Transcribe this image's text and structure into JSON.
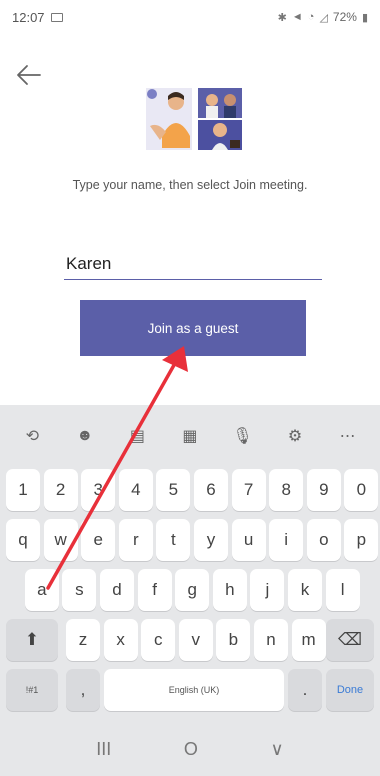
{
  "status_bar": {
    "time": "12:07",
    "battery": "72%"
  },
  "page": {
    "instruction": "Type your name, then select Join meeting.",
    "name_value": "Karen",
    "join_button_label": "Join as a guest"
  },
  "icons": {
    "back": "back-arrow-icon",
    "illustration": "meeting-people-illustration"
  },
  "keyboard": {
    "toolbar": [
      "translate-icon",
      "emoji-icon",
      "clipboard-icon",
      "keyboard-icon",
      "mic-icon",
      "settings-icon",
      "more-icon"
    ],
    "number_row": [
      "1",
      "2",
      "3",
      "4",
      "5",
      "6",
      "7",
      "8",
      "9",
      "0"
    ],
    "row1": [
      "q",
      "w",
      "e",
      "r",
      "t",
      "y",
      "u",
      "i",
      "o",
      "p"
    ],
    "row2": [
      "a",
      "s",
      "d",
      "f",
      "g",
      "h",
      "j",
      "k",
      "l"
    ],
    "row3": [
      "z",
      "x",
      "c",
      "v",
      "b",
      "n",
      "m"
    ],
    "symbols_label": "!#1",
    "comma_label": ",",
    "space_label": "English (UK)",
    "period_label": ".",
    "done_label": "Done"
  },
  "nav_bar": {
    "recents": "III",
    "home": "O",
    "back": "∨"
  },
  "colors": {
    "accent": "#5b5fa8",
    "annotation_arrow": "#e8303a"
  }
}
